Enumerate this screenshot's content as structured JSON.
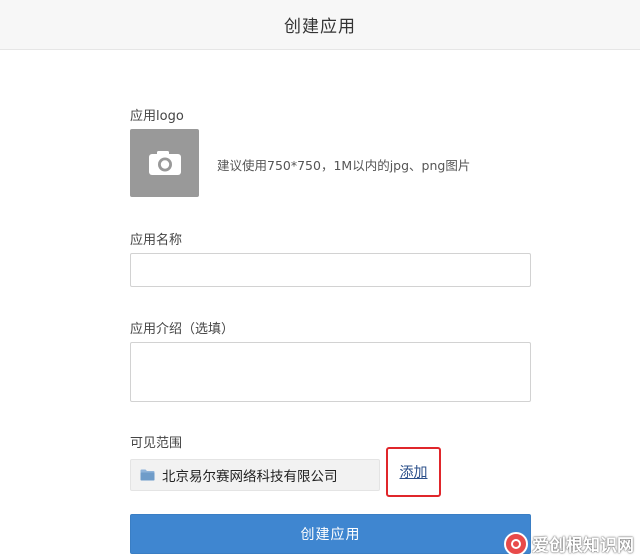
{
  "header": {
    "title": "创建应用"
  },
  "form": {
    "logo_label": "应用logo",
    "logo_hint": "建议使用750*750，1M以内的jpg、png图片",
    "name_label": "应用名称",
    "name_value": "",
    "intro_label": "应用介绍（选填）",
    "intro_value": "",
    "scope_label": "可见范围",
    "scope_items": [
      {
        "name": "北京易尔赛网络科技有限公司",
        "icon": "folder-icon"
      }
    ],
    "add_label": "添加",
    "submit_label": "创建应用"
  },
  "watermark": {
    "text": "爱创根知识网"
  },
  "colors": {
    "primary_button": "#3f86d0",
    "highlight_border": "#e0262b",
    "link": "#2b4f8a",
    "logo_placeholder": "#999999"
  }
}
